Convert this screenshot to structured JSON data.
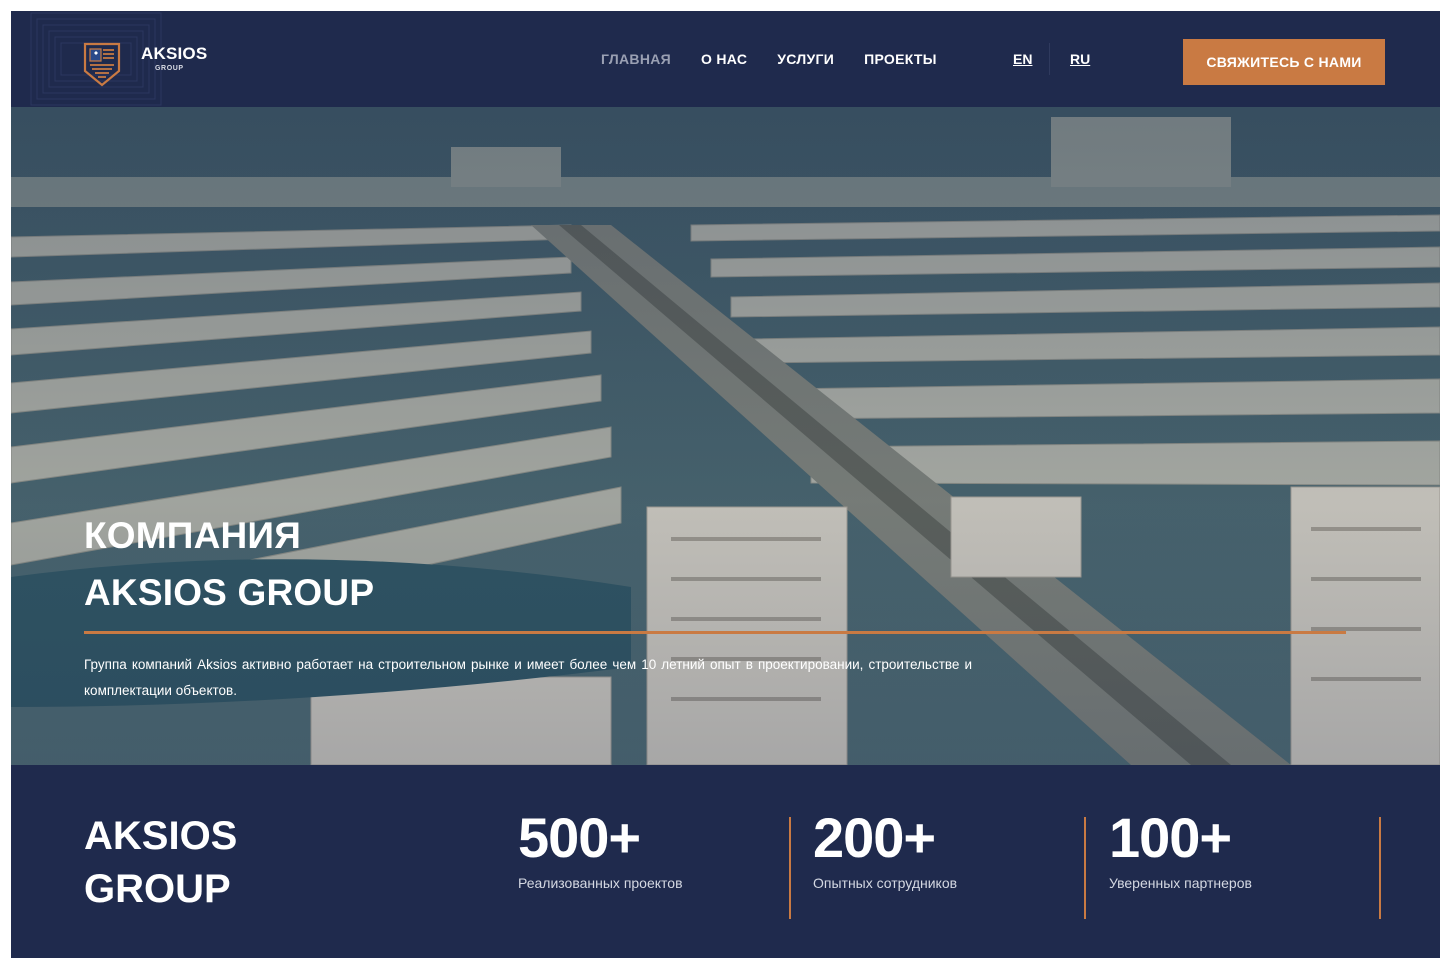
{
  "brand": {
    "name": "AKSIOS",
    "sub": "GROUP"
  },
  "nav": {
    "items": [
      {
        "label": "ГЛАВНАЯ",
        "active": true
      },
      {
        "label": "О НАС"
      },
      {
        "label": "УСЛУГИ"
      },
      {
        "label": "ПРОЕКТЫ"
      }
    ]
  },
  "lang": {
    "en": "EN",
    "ru": "RU"
  },
  "cta": {
    "label": "СВЯЖИТЕСЬ С НАМИ"
  },
  "hero": {
    "title_line1": "КОМПАНИЯ",
    "title_line2": "AKSIOS GROUP",
    "description": "Группа компаний Aksios активно работает на строительном рынке и имеет более чем 10 летний опыт в проектировании, строительстве и комплектации объектов."
  },
  "stats": {
    "brand_line1": "AKSIOS",
    "brand_line2": "GROUP",
    "items": [
      {
        "value": "500+",
        "label": "Реализованных проектов"
      },
      {
        "value": "200+",
        "label": "Опытных сотрудников"
      },
      {
        "value": "100+",
        "label": "Уверенных партнеров"
      }
    ]
  },
  "colors": {
    "navy": "#1f2a4d",
    "accent": "#c97a43",
    "muted_nav": "#9aa0b3"
  }
}
